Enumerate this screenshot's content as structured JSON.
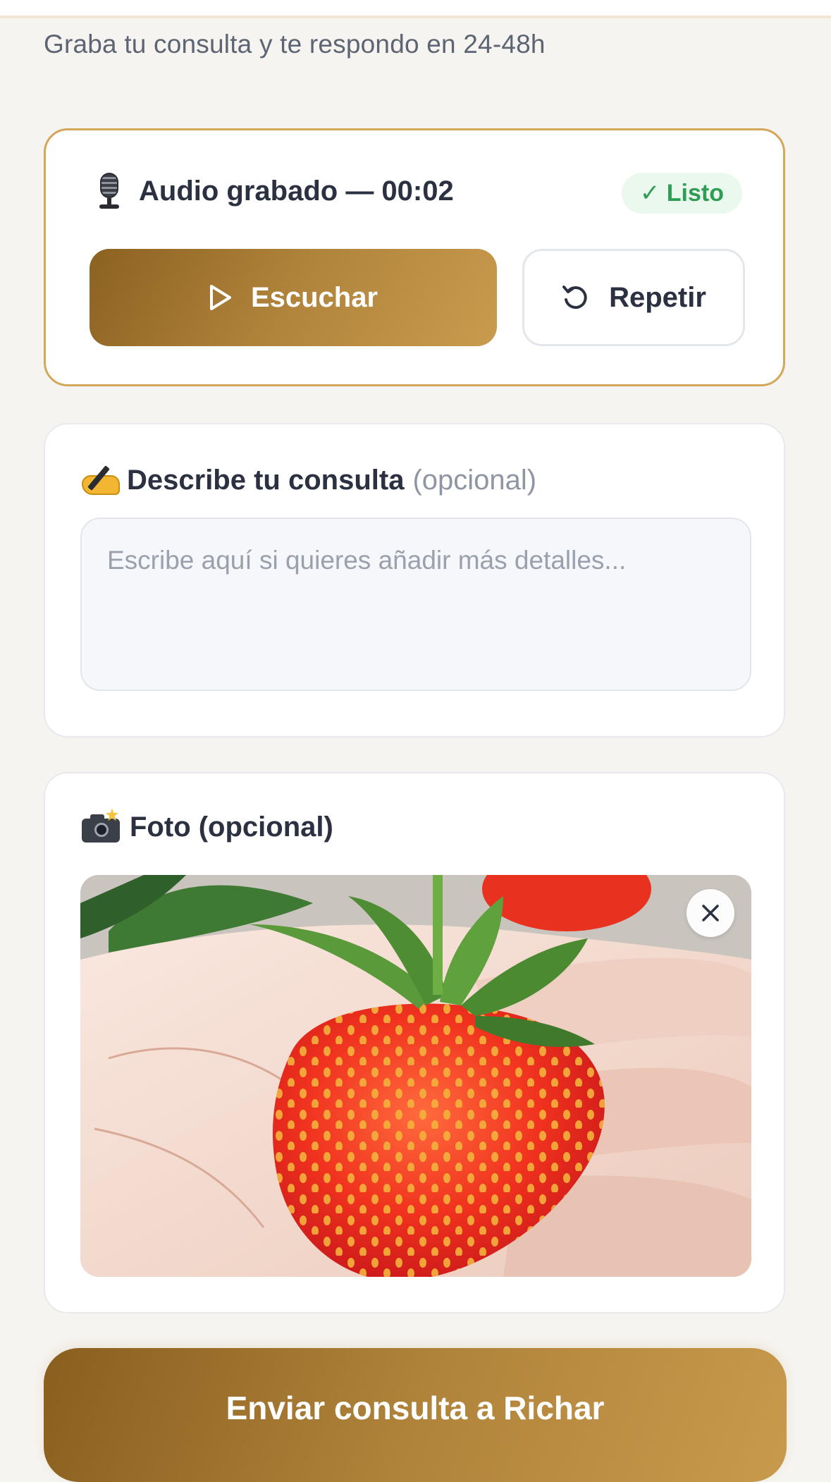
{
  "header": {
    "subtitle": "Graba tu consulta y te respondo en 24-48h"
  },
  "audio": {
    "icon": "microphone-icon",
    "title": "Audio grabado — 00:02",
    "status": "✓ Listo",
    "status_color": "#2f9e54",
    "listen_label": "Escuchar",
    "repeat_label": "Repetir"
  },
  "description": {
    "icon": "writing-hand-icon",
    "label": "Describe tu consulta",
    "optional": "(opcional)",
    "placeholder": "Escribe aquí si quieres añadir más detalles...",
    "value": ""
  },
  "photo": {
    "icon": "camera-flash-icon",
    "label": "Foto (opcional)"
  },
  "submit": {
    "label": "Enviar consulta a Richar"
  },
  "colors": {
    "accent_gold": "#b1843c",
    "background": "#f6f4f1",
    "ready_green": "#2f9e54"
  }
}
